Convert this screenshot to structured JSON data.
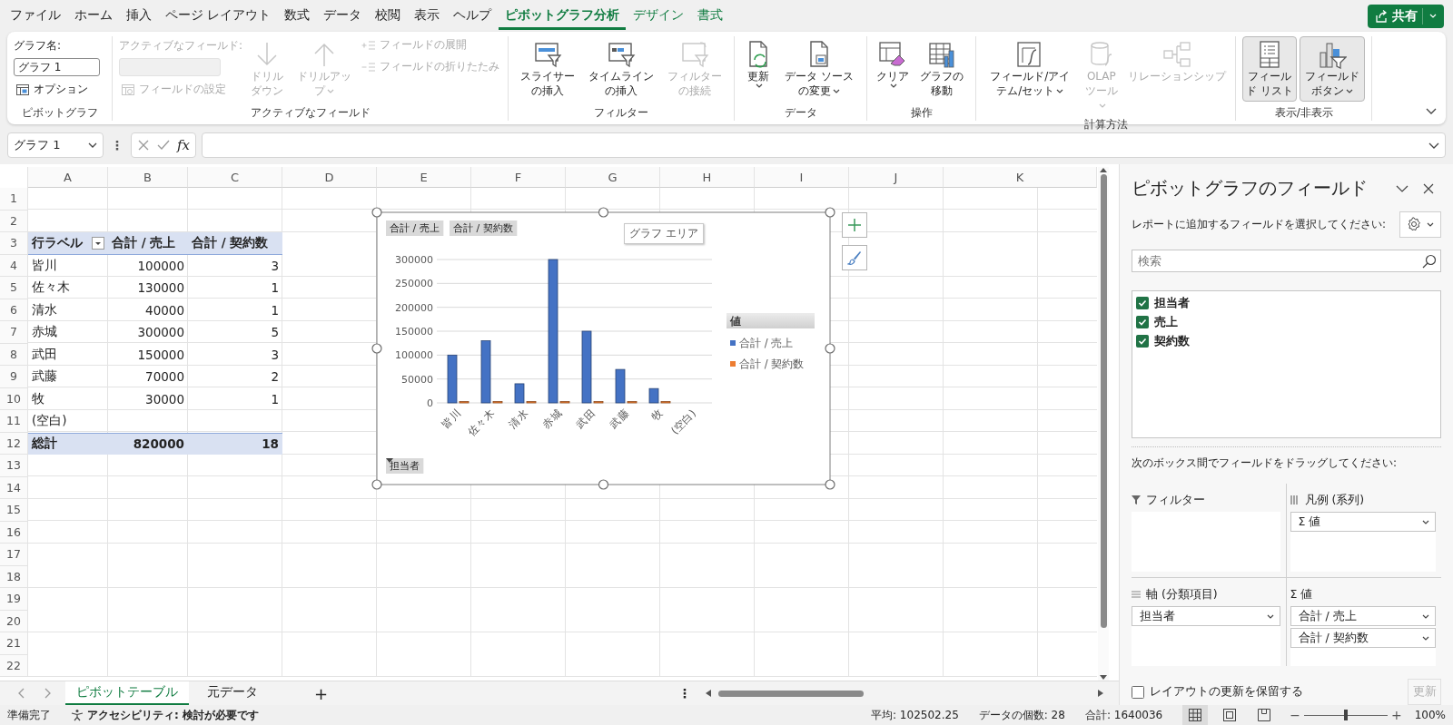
{
  "menu_tabs": [
    {
      "label": "ファイル",
      "selected": false,
      "contextual": false
    },
    {
      "label": "ホーム",
      "selected": false,
      "contextual": false
    },
    {
      "label": "挿入",
      "selected": false,
      "contextual": false
    },
    {
      "label": "ページ レイアウト",
      "selected": false,
      "contextual": false
    },
    {
      "label": "数式",
      "selected": false,
      "contextual": false
    },
    {
      "label": "データ",
      "selected": false,
      "contextual": false
    },
    {
      "label": "校閲",
      "selected": false,
      "contextual": false
    },
    {
      "label": "表示",
      "selected": false,
      "contextual": false
    },
    {
      "label": "ヘルプ",
      "selected": false,
      "contextual": false
    },
    {
      "label": "ピボットグラフ分析",
      "selected": true,
      "contextual": true
    },
    {
      "label": "デザイン",
      "selected": false,
      "contextual": true
    },
    {
      "label": "書式",
      "selected": false,
      "contextual": true
    }
  ],
  "share_button": {
    "label": "共有"
  },
  "ribbon": {
    "groups": [
      {
        "label": "ピボットグラフ",
        "columns": [
          [
            {
              "kind": "caption",
              "label": "グラフ名:",
              "disabled": false
            },
            {
              "kind": "field",
              "value": "グラフ 1",
              "disabled": false
            },
            {
              "kind": "small",
              "label": "オプション",
              "disabled": false
            }
          ]
        ]
      },
      {
        "label": "アクティブなフィールド",
        "columns": [
          [
            {
              "kind": "caption",
              "label": "アクティブなフィールド:",
              "disabled": true
            },
            {
              "kind": "field",
              "disabled": true
            },
            {
              "kind": "small",
              "label": "フィールドの設定",
              "disabled": true
            }
          ],
          [
            {
              "kind": "large",
              "label": "ドリルダウン",
              "disabled": true,
              "has_menu": false,
              "pressed": false
            }
          ],
          [
            {
              "kind": "large",
              "label": "ドリルアップ",
              "disabled": true,
              "has_menu": true,
              "pressed": false
            }
          ],
          [
            {
              "kind": "small",
              "label": "フィールドの展開",
              "disabled": true
            },
            {
              "kind": "small",
              "label": "フィールドの折りたたみ",
              "disabled": true
            }
          ]
        ]
      },
      {
        "label": "フィルター",
        "columns": [
          [
            {
              "kind": "large",
              "label": "スライサーの挿入",
              "disabled": false,
              "has_menu": false,
              "pressed": false
            }
          ],
          [
            {
              "kind": "large",
              "label": "タイムラインの挿入",
              "disabled": false,
              "has_menu": false,
              "pressed": false
            }
          ],
          [
            {
              "kind": "large",
              "label": "フィルターの接続",
              "disabled": true,
              "has_menu": false,
              "pressed": false
            }
          ]
        ]
      },
      {
        "label": "データ",
        "columns": [
          [
            {
              "kind": "large",
              "label": "更新",
              "disabled": false,
              "has_menu": true,
              "pressed": false
            }
          ],
          [
            {
              "kind": "large",
              "label": "データ ソースの変更",
              "disabled": false,
              "has_menu": true,
              "pressed": false
            }
          ]
        ]
      },
      {
        "label": "操作",
        "columns": [
          [
            {
              "kind": "large",
              "label": "クリア",
              "disabled": false,
              "has_menu": true,
              "pressed": false
            }
          ],
          [
            {
              "kind": "large",
              "label": "グラフの移動",
              "disabled": false,
              "has_menu": false,
              "pressed": false
            }
          ]
        ]
      },
      {
        "label": "計算方法",
        "columns": [
          [
            {
              "kind": "large",
              "label": "フィールド/アイテム/セット",
              "disabled": false,
              "has_menu": true,
              "pressed": false
            }
          ],
          [
            {
              "kind": "large",
              "label": "OLAP ツール",
              "disabled": true,
              "has_menu": true,
              "pressed": false
            }
          ],
          [
            {
              "kind": "large",
              "label": "リレーションシップ",
              "disabled": true,
              "has_menu": false,
              "pressed": false
            }
          ]
        ]
      },
      {
        "label": "表示/非表示",
        "columns": [
          [
            {
              "kind": "large",
              "label": "フィールド リスト",
              "disabled": false,
              "has_menu": false,
              "pressed": true
            }
          ],
          [
            {
              "kind": "large",
              "label": "フィールドボタン",
              "disabled": false,
              "has_menu": true,
              "pressed": true
            }
          ]
        ]
      }
    ]
  },
  "formula_bar": {
    "name_box": "グラフ 1",
    "separator": "⋮",
    "fx": "fx"
  },
  "sheet": {
    "column_letters": [
      "A",
      "B",
      "C",
      "D",
      "E",
      "F",
      "G",
      "H",
      "I",
      "J",
      "K"
    ],
    "row_numbers": [
      "1",
      "2",
      "3",
      "4",
      "5",
      "6",
      "7",
      "8",
      "9",
      "10",
      "11",
      "12",
      "13",
      "14",
      "15",
      "16",
      "17",
      "18",
      "19",
      "20",
      "21",
      "22"
    ]
  },
  "pivot_table": {
    "header": [
      "行ラベル",
      "合計 / 売上",
      "合計 / 契約数"
    ],
    "rows": [
      [
        "皆川",
        "100000",
        "3"
      ],
      [
        "佐々木",
        "130000",
        "1"
      ],
      [
        "清水",
        "40000",
        "1"
      ],
      [
        "赤城",
        "300000",
        "5"
      ],
      [
        "武田",
        "150000",
        "3"
      ],
      [
        "武藤",
        "70000",
        "2"
      ],
      [
        "牧",
        "30000",
        "1"
      ],
      [
        "(空白)"
      ]
    ],
    "total": [
      "総計",
      "820000",
      "18"
    ]
  },
  "chart": {
    "value_field_buttons": [
      "合計 / 売上",
      "合計 / 契約数"
    ],
    "axis_field_button": "担当者",
    "tooltip": "グラフ エリア",
    "chart_data": {
      "type": "bar",
      "legend": {
        "title": "値"
      },
      "grid": true,
      "categories": [
        "皆川",
        "佐々木",
        "清水",
        "赤城",
        "武田",
        "武藤",
        "牧",
        "(空白)"
      ],
      "series": [
        {
          "name": "合計 / 売上",
          "color": "#4472c4",
          "values": [
            100000,
            130000,
            40000,
            300000,
            150000,
            70000,
            30000,
            null
          ]
        },
        {
          "name": "合計 / 契約数",
          "color": "#ed7d31",
          "values": [
            3,
            1,
            1,
            5,
            3,
            2,
            1,
            null
          ]
        }
      ],
      "ylim": [
        0,
        300000
      ],
      "yticks": [
        0,
        50000,
        100000,
        150000,
        200000,
        250000,
        300000
      ]
    }
  },
  "sheet_tabs": [
    {
      "label": "ピボットテーブル",
      "selected": true
    },
    {
      "label": "元データ",
      "selected": false
    }
  ],
  "add_sheet": "+",
  "sheet_menu": "⋮",
  "field_pane": {
    "title": "ピボットグラフのフィールド",
    "instruction": "レポートに追加するフィールドを選択してください:",
    "search": {
      "placeholder": "検索"
    },
    "fields": [
      {
        "label": "担当者",
        "checked": true
      },
      {
        "label": "売上",
        "checked": true
      },
      {
        "label": "契約数",
        "checked": true
      }
    ],
    "drag_instruction": "次のボックス間でフィールドをドラッグしてください:",
    "areas": [
      {
        "kind": "filter",
        "label": "フィルター"
      },
      {
        "kind": "legend",
        "label": "凡例 (系列)",
        "items": [
          "Σ 値"
        ]
      },
      {
        "kind": "axis",
        "label": "軸 (分類項目)",
        "items": [
          "担当者"
        ]
      },
      {
        "kind": "values",
        "label": "Σ 値",
        "items": [
          "合計 / 売上",
          "合計 / 契約数"
        ]
      }
    ],
    "defer": {
      "label": "レイアウトの更新を保留する",
      "checked": false
    },
    "update_button": {
      "label": "更新",
      "disabled": true
    }
  },
  "status_bar": {
    "ready": "準備完了",
    "accessibility": "アクセシビリティ: 検討が必要です",
    "average": "平均: 102502.25",
    "count": "データの個数: 28",
    "sum": "合計: 1640036",
    "views": [
      {
        "selected": true
      },
      {
        "selected": false
      },
      {
        "selected": false
      }
    ],
    "zoom": {
      "out": "−",
      "in": "+",
      "level": 0.5,
      "label": "100%"
    }
  }
}
